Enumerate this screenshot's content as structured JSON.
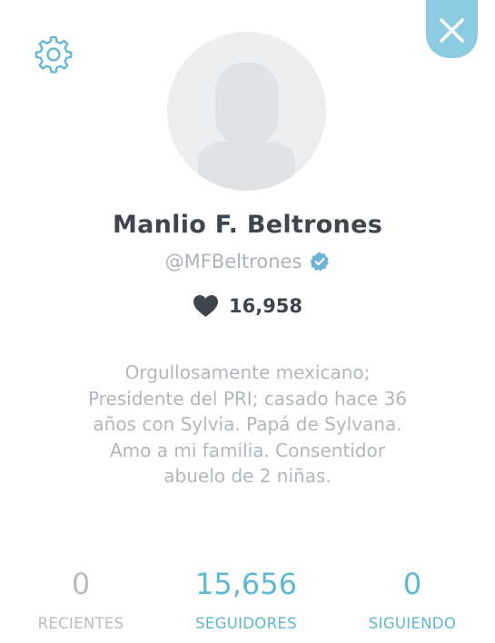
{
  "header": {
    "settings_icon": "gear-icon",
    "close_icon": "close-icon",
    "accent_color": "#8ccbe2"
  },
  "profile": {
    "avatar_icon": "default-avatar-icon",
    "name": "Manlio F. Beltrones",
    "handle": "@MFBeltrones",
    "verified_icon": "verified-badge-icon",
    "hearts_icon": "heart-icon",
    "hearts_count": "16,958",
    "bio_lines": [
      "Orgullosamente mexicano;",
      "Presidente del PRI; casado hace 36",
      "años con Sylvia. Papá de Sylvana.",
      "Amo a mi familia. Consentidor",
      "abuelo de 2 niñas."
    ]
  },
  "stats": {
    "recientes": {
      "value": "0",
      "label": "RECIENTES"
    },
    "seguidores": {
      "value": "15,656",
      "label": "SEGUIDORES"
    },
    "siguiendo": {
      "value": "0",
      "label": "SIGUIENDO"
    }
  }
}
